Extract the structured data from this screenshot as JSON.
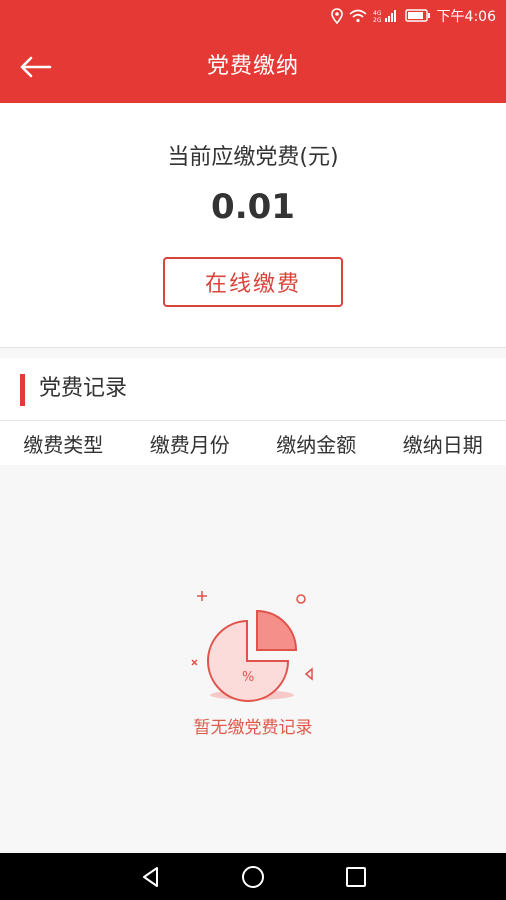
{
  "status_bar": {
    "time": "下午4:06",
    "icons": [
      "location-icon",
      "wifi-icon",
      "signal-icon",
      "battery-icon"
    ],
    "color": "#e53935"
  },
  "app_bar": {
    "title": "党费缴纳",
    "back_icon": "arrow-left-icon",
    "color": "#e53935"
  },
  "due": {
    "label": "当前应缴党费(元)",
    "amount": "0.01",
    "pay_button": "在线缴费"
  },
  "records": {
    "title": "党费记录",
    "columns": [
      "缴费类型",
      "缴费月份",
      "缴纳金额",
      "缴纳日期"
    ],
    "empty_icon": "pie-chart-percent-icon",
    "empty_text": "暂无缴党费记录"
  },
  "nav_bar": {
    "buttons": [
      "back-triangle-icon",
      "home-circle-icon",
      "recents-square-icon"
    ]
  },
  "colors": {
    "accent": "#e53935",
    "empty_text": "#e05a4c"
  }
}
